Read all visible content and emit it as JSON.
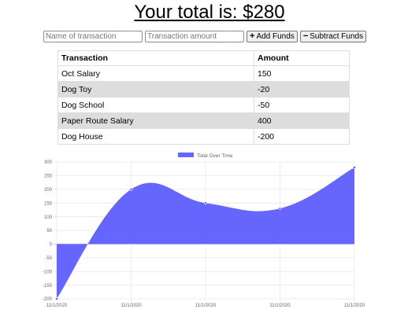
{
  "header": {
    "title": "Your total is: $280"
  },
  "form": {
    "name_placeholder": "Name of transaction",
    "amount_placeholder": "Transaction amount",
    "add_label": "Add Funds",
    "add_icon": "plus-icon",
    "subtract_label": "Subtract Funds",
    "subtract_icon": "minus-icon"
  },
  "table": {
    "headers": [
      "Transaction",
      "Amount"
    ],
    "rows": [
      {
        "name": "Oct Salary",
        "amount": "150"
      },
      {
        "name": "Dog Toy",
        "amount": "-20"
      },
      {
        "name": "Dog School",
        "amount": "-50"
      },
      {
        "name": "Paper Route Salary",
        "amount": "400"
      },
      {
        "name": "Dog House",
        "amount": "-200"
      }
    ]
  },
  "chart_data": {
    "type": "area",
    "legend": "Total Over Time",
    "legend_position": "top-center",
    "x": [
      "11/1/2020",
      "11/1/2020",
      "11/1/2020",
      "11/1/2020",
      "11/1/2020"
    ],
    "series": [
      {
        "name": "Total Over Time",
        "values": [
          -200,
          200,
          150,
          130,
          280
        ],
        "color": "#6666ff"
      }
    ],
    "ylim": [
      -200,
      300
    ],
    "yticks": [
      300,
      250,
      200,
      150,
      100,
      50,
      0,
      -50,
      -100,
      -150,
      -200
    ],
    "grid": true
  }
}
